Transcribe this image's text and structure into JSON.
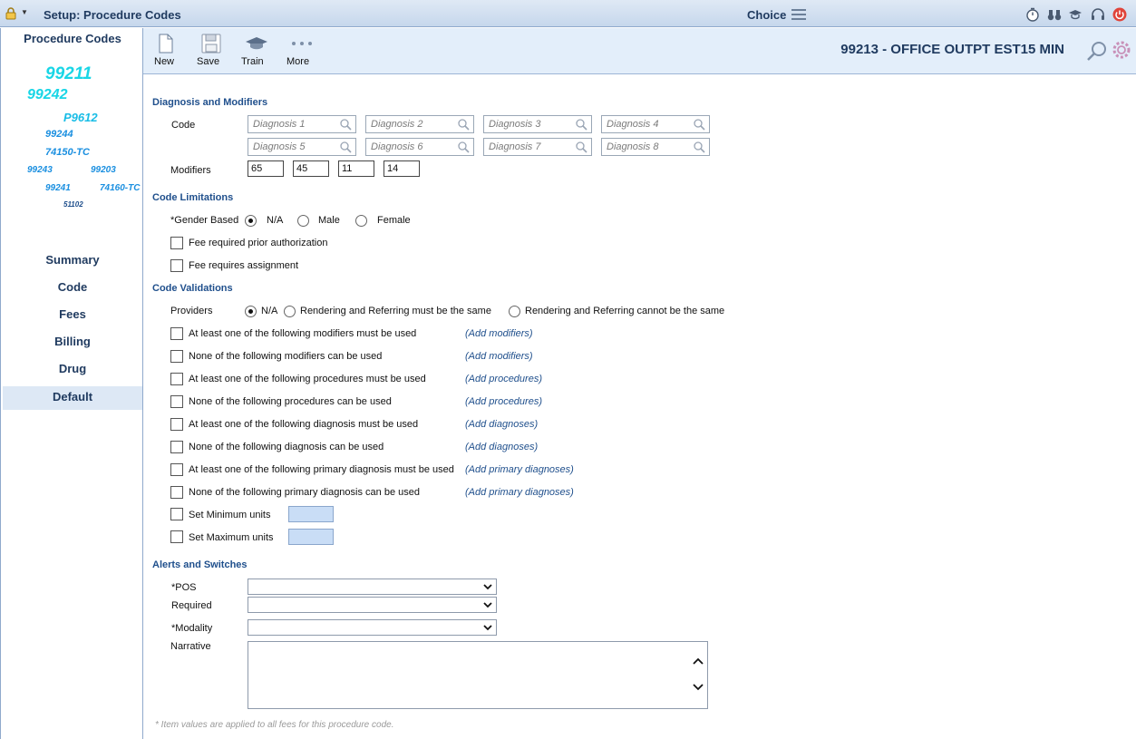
{
  "titlebar": {
    "title": "Setup: Procedure Codes",
    "choice_label": "Choice",
    "icons": [
      "lock-icon",
      "stopwatch-icon",
      "binoculars-icon",
      "graduation-cap-icon",
      "headset-icon",
      "power-icon"
    ]
  },
  "sidebar": {
    "heading": "Procedure Codes",
    "code_cloud": [
      "99211",
      "99242",
      "P9612",
      "99244",
      "74150-TC",
      "99243",
      "99203",
      "99241",
      "74160-TC",
      "51102"
    ],
    "nav": [
      "Summary",
      "Code",
      "Fees",
      "Billing",
      "Drug",
      "Default"
    ],
    "active_nav": "Default"
  },
  "toolbar": {
    "new_label": "New",
    "save_label": "Save",
    "train_label": "Train",
    "more_label": "More",
    "procedure_title": "99213 - OFFICE OUTPT EST15 MIN"
  },
  "diagnosis": {
    "section_title": "Diagnosis and Modifiers",
    "code_label": "Code",
    "placeholders": [
      "Diagnosis 1",
      "Diagnosis 2",
      "Diagnosis 3",
      "Diagnosis 4",
      "Diagnosis 5",
      "Diagnosis 6",
      "Diagnosis 7",
      "Diagnosis 8"
    ],
    "modifiers_label": "Modifiers",
    "modifiers": [
      "65",
      "45",
      "11",
      "14"
    ]
  },
  "limitations": {
    "section_title": "Code Limitations",
    "gender_label": "*Gender Based",
    "gender_options": [
      "N/A",
      "Male",
      "Female"
    ],
    "gender_selected": "N/A",
    "fee_prior_auth": "Fee required prior authorization",
    "fee_assignment": "Fee requires assignment"
  },
  "validations": {
    "section_title": "Code Validations",
    "providers_label": "Providers",
    "provider_options": [
      "N/A",
      "Rendering and Referring must be the same",
      "Rendering and Referring cannot be the same"
    ],
    "provider_selected": "N/A",
    "rules": [
      {
        "label": "At least one of the following modifiers must be used",
        "action": "(Add modifiers)"
      },
      {
        "label": "None of the following modifiers can be used",
        "action": "(Add modifiers)"
      },
      {
        "label": "At least one of the following procedures must be used",
        "action": "(Add procedures)"
      },
      {
        "label": "None of the following procedures can be used",
        "action": "(Add procedures)"
      },
      {
        "label": "At least one of the following diagnosis must be used",
        "action": "(Add diagnoses)"
      },
      {
        "label": "None of the following diagnosis can be used",
        "action": "(Add diagnoses)"
      },
      {
        "label": "At least one of the following primary diagnosis must be used",
        "action": "(Add primary diagnoses)"
      },
      {
        "label": "None of the following primary diagnosis can be used",
        "action": "(Add primary diagnoses)"
      }
    ],
    "min_units_label": "Set Minimum units",
    "max_units_label": "Set Maximum units"
  },
  "alerts": {
    "section_title": "Alerts and Switches",
    "pos_label": "*POS",
    "required_label": "Required",
    "modality_label": "*Modality",
    "narrative_label": "Narrative"
  },
  "footnote": "* Item values are applied to all fees for this procedure code.",
  "colors": {
    "header_bg": "#c6d7ec",
    "toolbar_bg": "#e3eefa",
    "section": "#1f4f8c",
    "accent": "#1a8fe0"
  }
}
